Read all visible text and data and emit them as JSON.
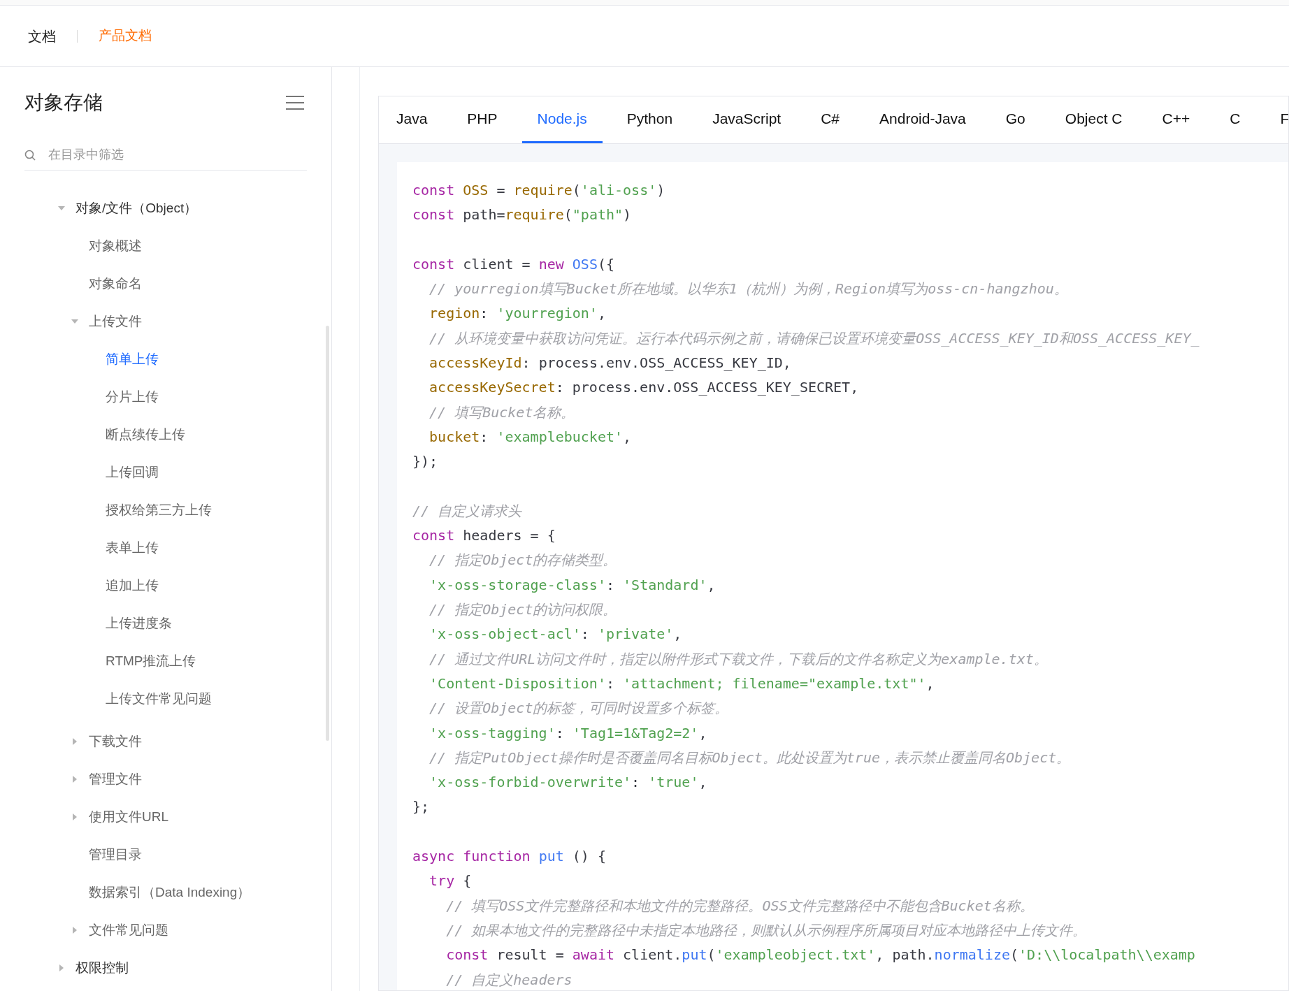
{
  "header": {
    "title": "文档",
    "product_link": "产品文档"
  },
  "sidebar": {
    "title": "对象存储",
    "search": {
      "placeholder": "在目录中筛选"
    },
    "tree": [
      {
        "label": "对象/文件（Object）",
        "expanded": true,
        "selected": false,
        "children": [
          {
            "label": "对象概述",
            "selected": false
          },
          {
            "label": "对象命名",
            "selected": false
          },
          {
            "label": "上传文件",
            "expanded": true,
            "selected": false,
            "children": [
              {
                "label": "简单上传",
                "selected": true
              },
              {
                "label": "分片上传",
                "selected": false
              },
              {
                "label": "断点续传上传",
                "selected": false
              },
              {
                "label": "上传回调",
                "selected": false
              },
              {
                "label": "授权给第三方上传",
                "selected": false
              },
              {
                "label": "表单上传",
                "selected": false
              },
              {
                "label": "追加上传",
                "selected": false
              },
              {
                "label": "上传进度条",
                "selected": false
              },
              {
                "label": "RTMP推流上传",
                "selected": false
              },
              {
                "label": "上传文件常见问题",
                "selected": false
              }
            ]
          },
          {
            "label": "下载文件",
            "expanded": false,
            "selected": false
          },
          {
            "label": "管理文件",
            "expanded": false,
            "selected": false
          },
          {
            "label": "使用文件URL",
            "expanded": false,
            "selected": false
          },
          {
            "label": "管理目录",
            "selected": false
          },
          {
            "label": "数据索引（Data Indexing）",
            "selected": false
          },
          {
            "label": "文件常见问题",
            "expanded": false,
            "selected": false
          }
        ]
      },
      {
        "label": "权限控制",
        "expanded": false,
        "selected": false
      }
    ]
  },
  "tabs": [
    {
      "label": "Java",
      "selected": false
    },
    {
      "label": "PHP",
      "selected": false
    },
    {
      "label": "Node.js",
      "selected": true
    },
    {
      "label": "Python",
      "selected": false
    },
    {
      "label": "JavaScript",
      "selected": false
    },
    {
      "label": "C#",
      "selected": false
    },
    {
      "label": "Android-Java",
      "selected": false
    },
    {
      "label": "Go",
      "selected": false
    },
    {
      "label": "Object C",
      "selected": false
    },
    {
      "label": "C++",
      "selected": false
    },
    {
      "label": "C",
      "selected": false
    },
    {
      "label": "F",
      "selected": false
    }
  ],
  "code_blocks": [
    [
      [
        {
          "kind": "kw",
          "text": "const"
        },
        {
          "kind": "def",
          "text": " OSS"
        },
        {
          "kind": "plain",
          "text": " = "
        },
        {
          "kind": "def",
          "text": "require"
        },
        {
          "kind": "plain",
          "text": "("
        },
        {
          "kind": "str",
          "text": "'ali-oss'"
        },
        {
          "kind": "plain",
          "text": ")"
        }
      ],
      [
        {
          "kind": "kw",
          "text": "const"
        },
        {
          "kind": "plain",
          "text": " path="
        },
        {
          "kind": "def",
          "text": "require"
        },
        {
          "kind": "plain",
          "text": "("
        },
        {
          "kind": "str",
          "text": "\"path\""
        },
        {
          "kind": "plain",
          "text": ")"
        }
      ]
    ],
    [
      [
        {
          "kind": "kw",
          "text": "const"
        },
        {
          "kind": "plain",
          "text": " client = "
        },
        {
          "kind": "kw",
          "text": "new"
        },
        {
          "kind": "fn",
          "text": " OSS"
        },
        {
          "kind": "plain",
          "text": "({"
        }
      ],
      [
        {
          "kind": "com",
          "text": "  // yourregion填写Bucket所在地域。以华东1（杭州）为例，Region填写为oss-cn-hangzhou。"
        }
      ],
      [
        {
          "kind": "def",
          "text": "  region"
        },
        {
          "kind": "plain",
          "text": ": "
        },
        {
          "kind": "str",
          "text": "'yourregion'"
        },
        {
          "kind": "plain",
          "text": ","
        }
      ],
      [
        {
          "kind": "com",
          "text": "  // 从环境变量中获取访问凭证。运行本代码示例之前，请确保已设置环境变量OSS_ACCESS_KEY_ID和OSS_ACCESS_KEY_"
        }
      ],
      [
        {
          "kind": "def",
          "text": "  accessKeyId"
        },
        {
          "kind": "plain",
          "text": ": process.env.OSS_ACCESS_KEY_ID,"
        }
      ],
      [
        {
          "kind": "def",
          "text": "  accessKeySecret"
        },
        {
          "kind": "plain",
          "text": ": process.env.OSS_ACCESS_KEY_SECRET,"
        }
      ],
      [
        {
          "kind": "com",
          "text": "  // 填写Bucket名称。"
        }
      ],
      [
        {
          "kind": "def",
          "text": "  bucket"
        },
        {
          "kind": "plain",
          "text": ": "
        },
        {
          "kind": "str",
          "text": "'examplebucket'"
        },
        {
          "kind": "plain",
          "text": ","
        }
      ],
      [
        {
          "kind": "plain",
          "text": "});"
        }
      ]
    ],
    [
      [
        {
          "kind": "com",
          "text": "// 自定义请求头"
        }
      ],
      [
        {
          "kind": "kw",
          "text": "const"
        },
        {
          "kind": "plain",
          "text": " headers = {"
        }
      ],
      [
        {
          "kind": "com",
          "text": "  // 指定Object的存储类型。"
        }
      ],
      [
        {
          "kind": "str",
          "text": "  'x-oss-storage-class'"
        },
        {
          "kind": "plain",
          "text": ": "
        },
        {
          "kind": "str",
          "text": "'Standard'"
        },
        {
          "kind": "plain",
          "text": ","
        }
      ],
      [
        {
          "kind": "com",
          "text": "  // 指定Object的访问权限。"
        }
      ],
      [
        {
          "kind": "str",
          "text": "  'x-oss-object-acl'"
        },
        {
          "kind": "plain",
          "text": ": "
        },
        {
          "kind": "str",
          "text": "'private'"
        },
        {
          "kind": "plain",
          "text": ","
        }
      ],
      [
        {
          "kind": "com",
          "text": "  // 通过文件URL访问文件时，指定以附件形式下载文件，下载后的文件名称定义为example.txt。"
        }
      ],
      [
        {
          "kind": "str",
          "text": "  'Content-Disposition'"
        },
        {
          "kind": "plain",
          "text": ": "
        },
        {
          "kind": "str",
          "text": "'attachment; filename=\"example.txt\"'"
        },
        {
          "kind": "plain",
          "text": ","
        }
      ],
      [
        {
          "kind": "com",
          "text": "  // 设置Object的标签，可同时设置多个标签。"
        }
      ],
      [
        {
          "kind": "str",
          "text": "  'x-oss-tagging'"
        },
        {
          "kind": "plain",
          "text": ": "
        },
        {
          "kind": "str",
          "text": "'Tag1=1&Tag2=2'"
        },
        {
          "kind": "plain",
          "text": ","
        }
      ],
      [
        {
          "kind": "com",
          "text": "  // 指定PutObject操作时是否覆盖同名目标Object。此处设置为true，表示禁止覆盖同名Object。"
        }
      ],
      [
        {
          "kind": "str",
          "text": "  'x-oss-forbid-overwrite'"
        },
        {
          "kind": "plain",
          "text": ": "
        },
        {
          "kind": "str",
          "text": "'true'"
        },
        {
          "kind": "plain",
          "text": ","
        }
      ],
      [
        {
          "kind": "plain",
          "text": "};"
        }
      ]
    ],
    [
      [
        {
          "kind": "kw",
          "text": "async"
        },
        {
          "kind": "kw",
          "text": " function"
        },
        {
          "kind": "fn",
          "text": " put"
        },
        {
          "kind": "plain",
          "text": " () {"
        }
      ],
      [
        {
          "kind": "kw",
          "text": "  try"
        },
        {
          "kind": "plain",
          "text": " {"
        }
      ],
      [
        {
          "kind": "com",
          "text": "    // 填写OSS文件完整路径和本地文件的完整路径。OSS文件完整路径中不能包含Bucket名称。"
        }
      ],
      [
        {
          "kind": "com",
          "text": "    // 如果本地文件的完整路径中未指定本地路径，则默认从示例程序所属项目对应本地路径中上传文件。"
        }
      ],
      [
        {
          "kind": "kw",
          "text": "    const"
        },
        {
          "kind": "plain",
          "text": " result = "
        },
        {
          "kind": "kw",
          "text": "await"
        },
        {
          "kind": "plain",
          "text": " client."
        },
        {
          "kind": "fn",
          "text": "put"
        },
        {
          "kind": "plain",
          "text": "("
        },
        {
          "kind": "str",
          "text": "'exampleobject.txt'"
        },
        {
          "kind": "plain",
          "text": ", path."
        },
        {
          "kind": "fn",
          "text": "normalize"
        },
        {
          "kind": "plain",
          "text": "("
        },
        {
          "kind": "str",
          "text": "'D:\\\\localpath\\\\examp"
        }
      ],
      [
        {
          "kind": "com",
          "text": "    // 自定义headers"
        }
      ]
    ]
  ]
}
